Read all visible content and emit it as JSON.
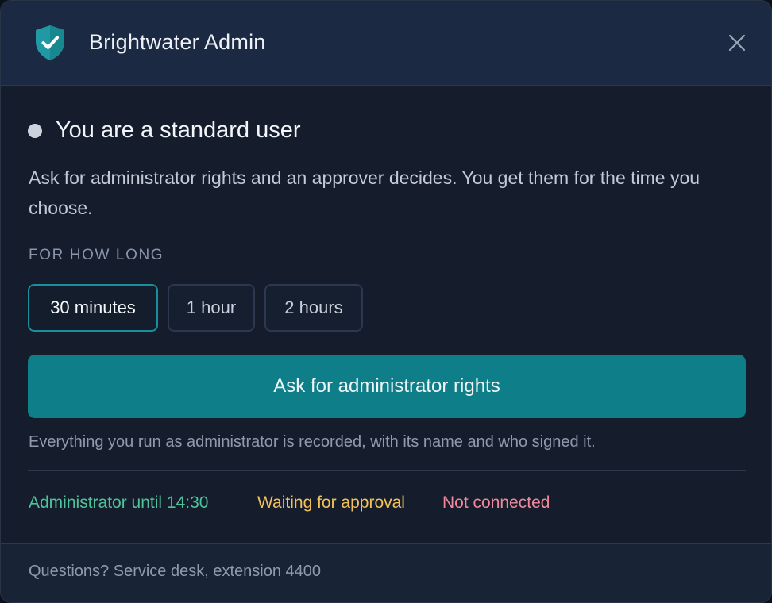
{
  "window": {
    "title": "Brightwater Admin",
    "logo_icon": "shield-check-icon",
    "close_icon": "close-icon"
  },
  "status": {
    "title": "You are a standard user",
    "description": "Ask for administrator rights and an approver decides. You get them for the time you choose."
  },
  "duration": {
    "label": "FOR HOW LONG",
    "options": [
      "30 minutes",
      "1 hour",
      "2 hours"
    ],
    "selected": "30 minutes"
  },
  "request": {
    "button_label": "Ask for administrator rights",
    "audit_note": "Everything you run as administrator is recorded, with its name and who signed it."
  },
  "states": [
    {
      "label": "Administrator until 14:30",
      "color": "#4fc29a"
    },
    {
      "label": "Waiting for approval",
      "color": "#f2c15a"
    },
    {
      "label": "Not connected",
      "color": "#f0889b"
    }
  ],
  "footer": {
    "text": "Questions? Service desk, extension 4400"
  },
  "colors": {
    "accent": "#0e7e88",
    "selected_border": "#1a8f9c",
    "shield": "#1f9aa4"
  }
}
